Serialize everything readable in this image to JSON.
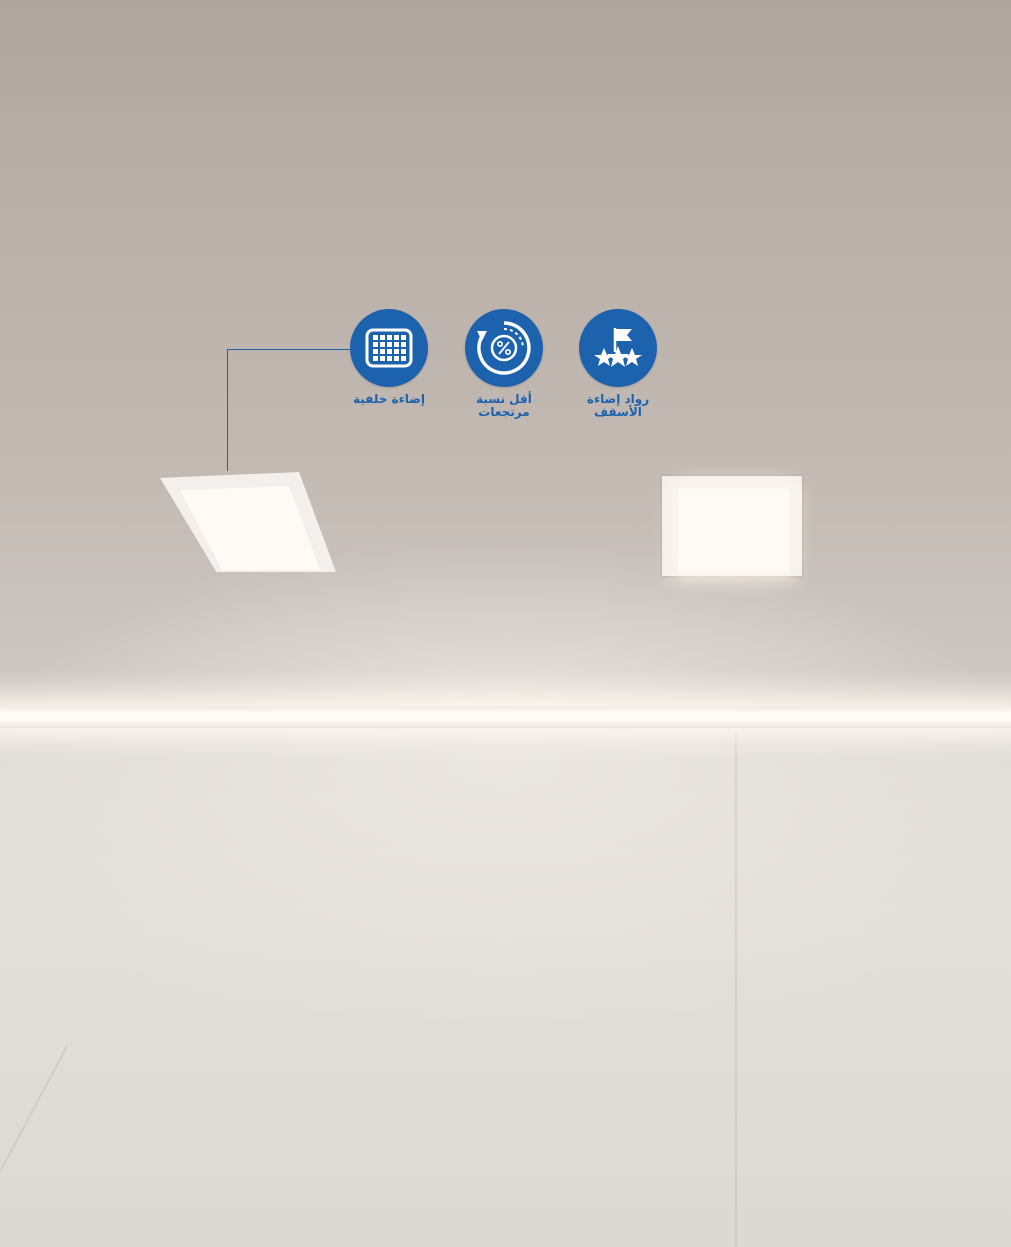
{
  "features": [
    {
      "label": "إضاءة خلفية",
      "icon": "grid-panel-icon"
    },
    {
      "label": "أقل نسبة مرتجعات",
      "icon": "percent-cycle-icon"
    },
    {
      "label": "رواد إضاءة الأسقف",
      "icon": "flag-stars-icon"
    }
  ],
  "colors": {
    "brand_blue": "#1d62ad",
    "ceiling": "#bab0a9",
    "light": "#fffaf4"
  }
}
